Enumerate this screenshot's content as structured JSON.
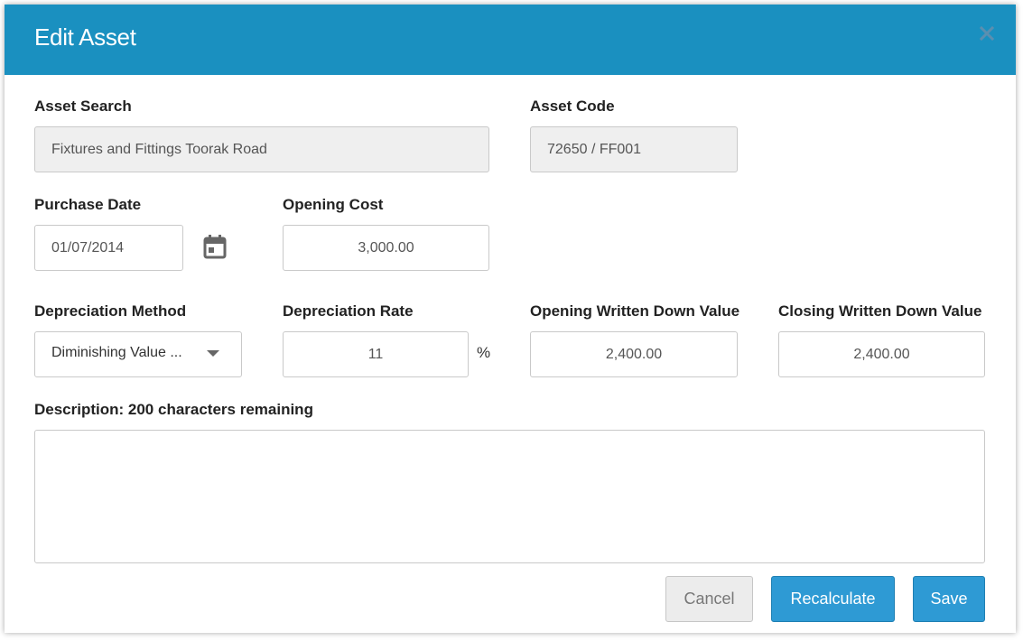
{
  "dialog": {
    "title": "Edit Asset",
    "accent_color": "#1a90c0",
    "close_icon": "close-icon"
  },
  "form": {
    "asset_search": {
      "label": "Asset Search",
      "value": "Fixtures and Fittings Toorak Road"
    },
    "asset_code": {
      "label": "Asset Code",
      "value": "72650 / FF001"
    },
    "purchase_date": {
      "label": "Purchase Date",
      "value": "01/07/2014",
      "icon": "calendar-icon"
    },
    "opening_cost": {
      "label": "Opening Cost",
      "value": "3,000.00"
    },
    "depreciation_method": {
      "label": "Depreciation Method",
      "value": "Diminishing Value ...",
      "icon": "chevron-down-icon"
    },
    "depreciation_rate": {
      "label": "Depreciation Rate",
      "value": "11",
      "unit": "%"
    },
    "opening_wdv": {
      "label": "Opening Written Down Value",
      "value": "2,400.00"
    },
    "closing_wdv": {
      "label": "Closing Written Down Value",
      "value": "2,400.00"
    },
    "description": {
      "label": "Description: 200 characters remaining",
      "value": ""
    }
  },
  "buttons": {
    "cancel": "Cancel",
    "recalculate": "Recalculate",
    "save": "Save",
    "primary_color": "#2e9ad4"
  }
}
